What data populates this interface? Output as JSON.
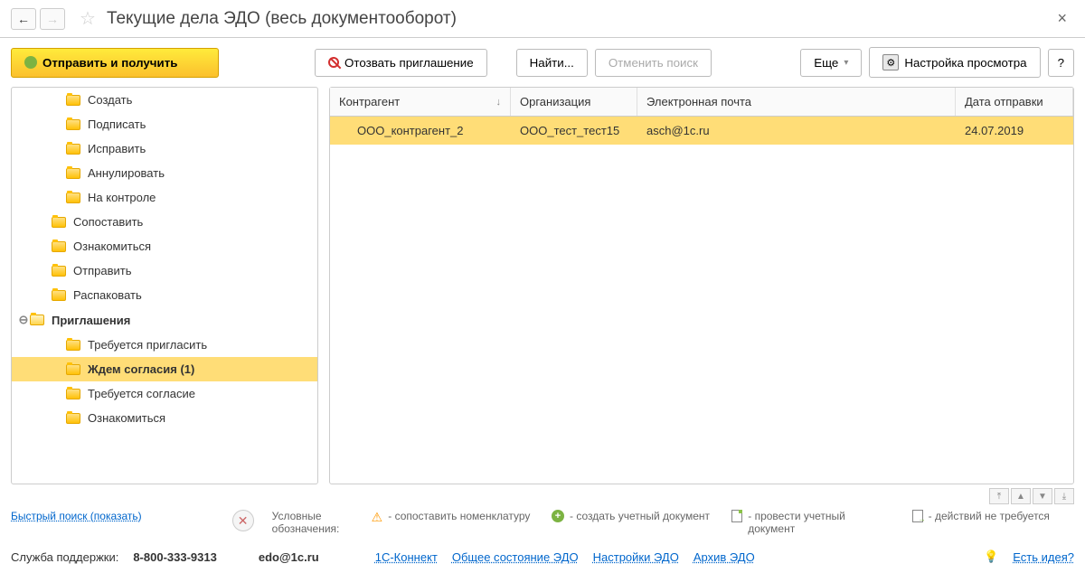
{
  "header": {
    "title": "Текущие дела ЭДО (весь документооборот)"
  },
  "toolbar": {
    "send_receive": "Отправить и получить",
    "revoke": "Отозвать приглашение",
    "find": "Найти...",
    "cancel_search": "Отменить поиск",
    "more": "Еще",
    "view_settings": "Настройка просмотра",
    "help": "?"
  },
  "tree": {
    "items": [
      {
        "label": "Создать",
        "indent": 2
      },
      {
        "label": "Подписать",
        "indent": 2
      },
      {
        "label": "Исправить",
        "indent": 2
      },
      {
        "label": "Аннулировать",
        "indent": 2
      },
      {
        "label": "На контроле",
        "indent": 2
      },
      {
        "label": "Сопоставить",
        "indent": 1
      },
      {
        "label": "Ознакомиться",
        "indent": 1
      },
      {
        "label": "Отправить",
        "indent": 1
      },
      {
        "label": "Распаковать",
        "indent": 1
      },
      {
        "label": "Приглашения",
        "indent": 0,
        "bold": true,
        "expandable": true,
        "open": true
      },
      {
        "label": "Требуется пригласить",
        "indent": 2
      },
      {
        "label": "Ждем согласия (1)",
        "indent": 2,
        "bold": true,
        "selected": true
      },
      {
        "label": "Требуется согласие",
        "indent": 2
      },
      {
        "label": "Ознакомиться",
        "indent": 2
      }
    ]
  },
  "table": {
    "columns": {
      "c1": "Контрагент",
      "c2": "Организация",
      "c3": "Электронная почта",
      "c4": "Дата отправки"
    },
    "rows": [
      {
        "c1": "ООО_контрагент_2",
        "c2": "ООО_тест_тест15",
        "c3": "asch@1c.ru",
        "c4": "24.07.2019"
      }
    ]
  },
  "legend": {
    "quick_search": "Быстрый поиск (показать)",
    "label": "Условные обозначения:",
    "items": [
      "- сопоставить номенклатуру",
      "- создать учетный документ",
      "- провести учетный документ",
      "- действий не требуется"
    ]
  },
  "footer": {
    "support_label": "Служба поддержки:",
    "phone": "8-800-333-9313",
    "email": "edo@1c.ru",
    "links": [
      "1С-Коннект",
      "Общее состояние ЭДО",
      "Настройки ЭДО",
      "Архив ЭДО"
    ],
    "idea": "Есть идея?"
  }
}
